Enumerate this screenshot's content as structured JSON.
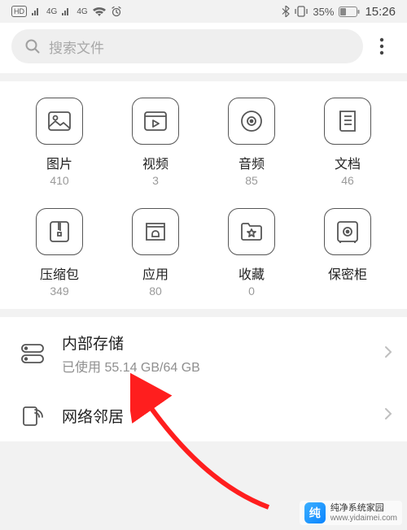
{
  "status": {
    "hd_badge": "HD",
    "signal1": "4G",
    "signal2": "4G",
    "bluetooth_icon": "bluetooth-icon",
    "vibrate_icon": "vibrate-icon",
    "battery_pct": "35%",
    "time": "15:26"
  },
  "search": {
    "placeholder": "搜索文件"
  },
  "categories": [
    {
      "key": "images",
      "label": "图片",
      "count": "410"
    },
    {
      "key": "videos",
      "label": "视频",
      "count": "3"
    },
    {
      "key": "audio",
      "label": "音频",
      "count": "85"
    },
    {
      "key": "documents",
      "label": "文档",
      "count": "46"
    },
    {
      "key": "archives",
      "label": "压缩包",
      "count": "349"
    },
    {
      "key": "apps",
      "label": "应用",
      "count": "80"
    },
    {
      "key": "favorites",
      "label": "收藏",
      "count": "0"
    },
    {
      "key": "safe",
      "label": "保密柜",
      "count": ""
    }
  ],
  "storage": {
    "title": "内部存储",
    "used_label": "已使用 55.14 GB/64 GB",
    "used_gb": 55.14,
    "total_gb": 64
  },
  "network": {
    "title": "网络邻居"
  },
  "watermark": {
    "name": "纯净系统家园",
    "url": "www.yidaimei.com"
  }
}
